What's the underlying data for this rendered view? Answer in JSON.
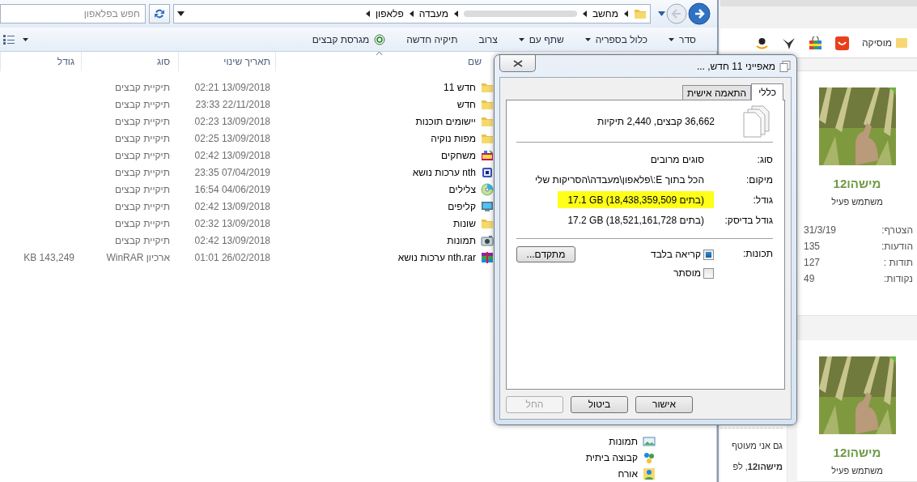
{
  "explorer": {
    "search": {
      "placeholder": "חפש בפלאפון"
    },
    "breadcrumbs": [
      {
        "kind": "crumb",
        "label": "מחשב"
      },
      {
        "kind": "redacted"
      },
      {
        "kind": "crumb",
        "label": "מעבדה"
      },
      {
        "kind": "crumb",
        "label": "פלאפון"
      }
    ],
    "toolbar": [
      {
        "kind": "menu",
        "label": "סדר"
      },
      {
        "kind": "menu",
        "label": "כלול בספריה"
      },
      {
        "kind": "menu",
        "label": "שתף עם"
      },
      {
        "kind": "plain",
        "label": "צרוב"
      },
      {
        "kind": "plain",
        "label": "תיקיה חדשה"
      },
      {
        "kind": "app",
        "label": "מגרסת קבצים"
      }
    ],
    "columns": [
      "שם",
      "תאריך שינוי",
      "סוג",
      "גודל"
    ],
    "rows": [
      {
        "kind": "folder",
        "name": "חדש 11",
        "modified": "13/09/2018 02:21",
        "type": "תיקיית קבצים"
      },
      {
        "kind": "folder",
        "name": "חדש",
        "modified": "22/11/2018 23:33",
        "type": "תיקיית קבצים"
      },
      {
        "kind": "folder",
        "name": "יישומים תוכנות",
        "modified": "13/09/2018 02:23",
        "type": "תיקיית קבצים"
      },
      {
        "kind": "folder",
        "name": "מפות נוקיה",
        "modified": "13/09/2018 02:25",
        "type": "תיקיית קבצים"
      },
      {
        "kind": "games",
        "name": "משחקים",
        "modified": "13/09/2018 02:42",
        "type": "תיקיית קבצים"
      },
      {
        "kind": "media",
        "name": "nth ערכות נושא",
        "modified": "07/04/2019 23:35",
        "type": "תיקיית קבצים"
      },
      {
        "kind": "disc",
        "name": "צלילים",
        "modified": "04/06/2019 16:54",
        "type": "תיקיית קבצים"
      },
      {
        "kind": "monitor",
        "name": "קליפים",
        "modified": "13/09/2018 02:42",
        "type": "תיקיית קבצים"
      },
      {
        "kind": "folder",
        "name": "שונות",
        "modified": "13/09/2018 02:32",
        "type": "תיקיית קבצים"
      },
      {
        "kind": "camera",
        "name": "תמונות",
        "modified": "13/09/2018 02:42",
        "type": "תיקיית קבצים"
      },
      {
        "kind": "archive",
        "name": "nth.rar ערכות נושא",
        "modified": "26/02/2018 01:01",
        "type": "ארכיון WinRAR",
        "size": "143,249 KB"
      }
    ],
    "nav_items": [
      {
        "kind": "pictures",
        "label": "תמונות"
      },
      {
        "kind": "homegroup",
        "label": "קבוצה ביתית"
      },
      {
        "kind": "user",
        "label": "אורח"
      }
    ]
  },
  "dialog": {
    "title": "מאפייני 11 חדש, ...",
    "tabs": [
      {
        "label": "כללי",
        "selected": true
      },
      {
        "label": "התאמה אישית",
        "selected": false
      }
    ],
    "summary": "36,662 קבצים, 2,440 תיקיות",
    "fields": [
      {
        "label": "סוג:",
        "value": "סוגים מרובים",
        "highlighted": false
      },
      {
        "label": "מיקום:",
        "value": "הכל בתוך E:\\פלאפון\\מעבדה\\הסריקות שלי",
        "highlighted": false
      },
      {
        "label": "גודל:",
        "value": "17.1 GB (18,438,359,509 בתים)",
        "highlighted": true
      },
      {
        "label": "גודל בדיסק:",
        "value": "17.2 GB (18,521,161,728 בתים)",
        "highlighted": false
      }
    ],
    "attributes_label": "תכונות:",
    "attributes": [
      {
        "label": "קריאה בלבד",
        "indeterminate": true
      },
      {
        "label": "מוסתר",
        "indeterminate": false
      }
    ],
    "advanced_button": "מתקדם...",
    "buttons": [
      {
        "label": "אישור",
        "disabled": false
      },
      {
        "label": "ביטול",
        "disabled": false
      },
      {
        "label": "החל",
        "disabled": true
      }
    ]
  },
  "browser": {
    "bookmarks": [
      {
        "kind": "folder",
        "label": "מוסיקה"
      },
      {
        "kind": "shop"
      },
      {
        "kind": "bag"
      },
      {
        "kind": "bird"
      },
      {
        "kind": "smile"
      }
    ],
    "posts": [
      "גם אני מעוטף",
      "**מישהו12**, לפ"
    ],
    "profiles": [
      {
        "name": "מישהו12",
        "role": "משתמש פעיל",
        "online": true,
        "stats": [
          {
            "label": "הצטרף:",
            "value": "31/3/19"
          },
          {
            "label": "הודעות:",
            "value": "135"
          },
          {
            "label": "תודות :",
            "value": "127"
          },
          {
            "label": "נקודות:",
            "value": "49"
          }
        ]
      },
      {
        "name": "מישהו12",
        "role": "משתמש פעיל",
        "online": true
      }
    ]
  }
}
